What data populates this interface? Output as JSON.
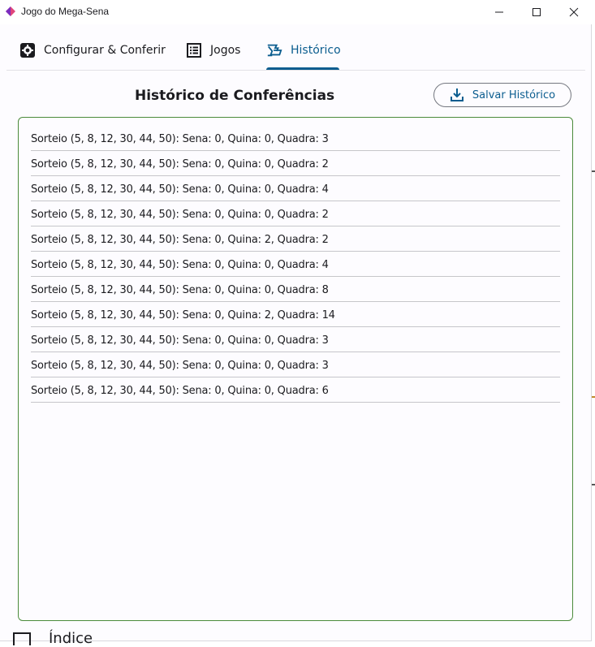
{
  "window": {
    "title": "Jogo do Mega-Sena"
  },
  "tabs": [
    {
      "label": "Configurar & Conferir",
      "icon": "gear-icon",
      "selected": false
    },
    {
      "label": "Jogos",
      "icon": "list-icon",
      "selected": false
    },
    {
      "label": "Histórico",
      "icon": "history-icon",
      "selected": true
    }
  ],
  "historico": {
    "title": "Histórico de Conferências",
    "save_label": "Salvar Histórico",
    "save_icon": "download-icon",
    "entries": [
      "Sorteio (5, 8, 12, 30, 44, 50): Sena: 0, Quina: 0, Quadra: 3",
      "Sorteio (5, 8, 12, 30, 44, 50): Sena: 0, Quina: 0, Quadra: 2",
      "Sorteio (5, 8, 12, 30, 44, 50): Sena: 0, Quina: 0, Quadra: 4",
      "Sorteio (5, 8, 12, 30, 44, 50): Sena: 0, Quina: 0, Quadra: 2",
      "Sorteio (5, 8, 12, 30, 44, 50): Sena: 0, Quina: 2, Quadra: 2",
      "Sorteio (5, 8, 12, 30, 44, 50): Sena: 0, Quina: 0, Quadra: 4",
      "Sorteio (5, 8, 12, 30, 44, 50): Sena: 0, Quina: 0, Quadra: 8",
      "Sorteio (5, 8, 12, 30, 44, 50): Sena: 0, Quina: 2, Quadra: 14",
      "Sorteio (5, 8, 12, 30, 44, 50): Sena: 0, Quina: 0, Quadra: 3",
      "Sorteio (5, 8, 12, 30, 44, 50): Sena: 0, Quina: 0, Quadra: 3",
      "Sorteio (5, 8, 12, 30, 44, 50): Sena: 0, Quina: 0, Quadra: 6"
    ]
  },
  "background": {
    "fragment_label": "Índice"
  },
  "colors": {
    "accent": "#0b5d8f",
    "list_border": "#4b8b3b",
    "divider": "#c6c6ca"
  }
}
